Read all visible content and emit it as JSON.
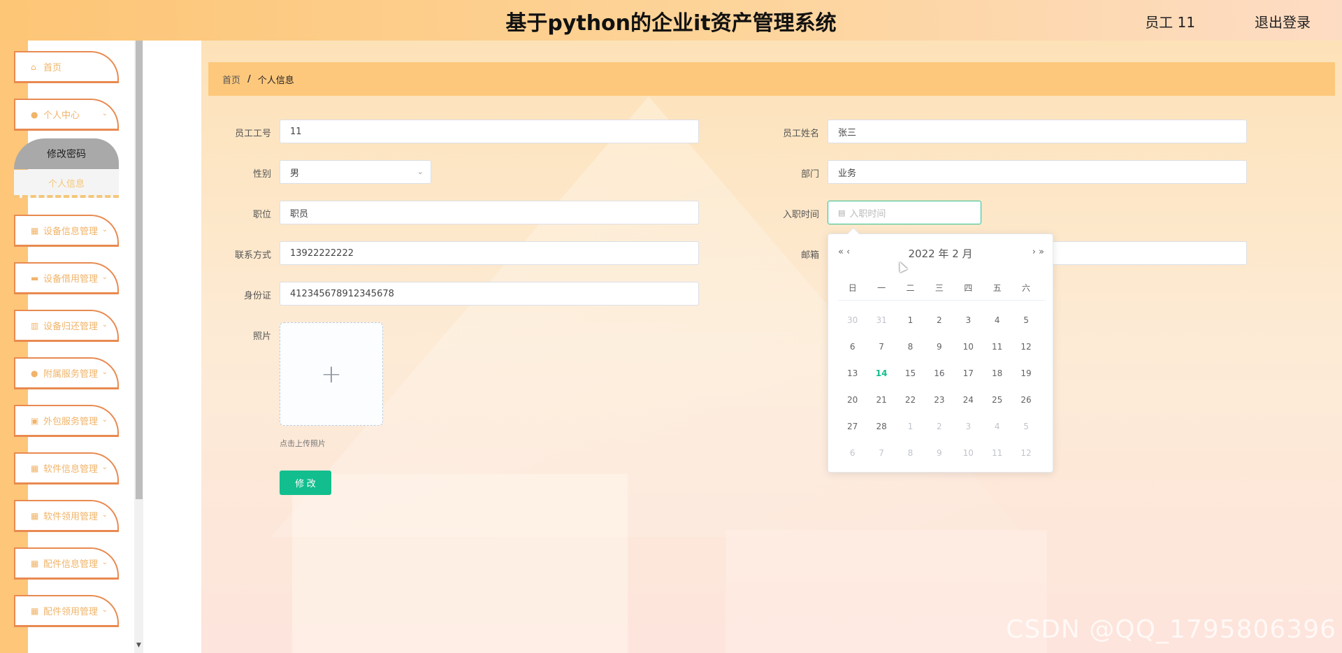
{
  "header": {
    "title": "基于python的企业it资产管理系统",
    "user": "员工 11",
    "logout": "退出登录"
  },
  "sidebar": {
    "items": [
      {
        "label": "首页",
        "icon": "home-icon"
      },
      {
        "label": "个人中心",
        "icon": "user-icon"
      },
      {
        "label": "设备信息管理",
        "icon": "grid-icon"
      },
      {
        "label": "设备借用管理",
        "icon": "video-icon"
      },
      {
        "label": "设备归还管理",
        "icon": "chart-icon"
      },
      {
        "label": "附属服务管理",
        "icon": "user-icon"
      },
      {
        "label": "外包服务管理",
        "icon": "briefcase-icon"
      },
      {
        "label": "软件信息管理",
        "icon": "grid-icon"
      },
      {
        "label": "软件领用管理",
        "icon": "grid-icon"
      },
      {
        "label": "配件信息管理",
        "icon": "grid-icon"
      },
      {
        "label": "配件领用管理",
        "icon": "grid-icon"
      }
    ],
    "submenu": {
      "active": "修改密码",
      "other": "个人信息"
    }
  },
  "breadcrumb": {
    "home": "首页",
    "separator": "/",
    "current": "个人信息"
  },
  "form": {
    "emp_no_label": "员工工号",
    "emp_no": "11",
    "emp_name_label": "员工姓名",
    "emp_name": "张三",
    "gender_label": "性别",
    "gender": "男",
    "dept_label": "部门",
    "dept": "业务",
    "position_label": "职位",
    "position": "职员",
    "hire_label": "入职时间",
    "hire_placeholder": "入职时间",
    "phone_label": "联系方式",
    "phone": "13922222222",
    "email_label": "邮箱",
    "id_label": "身份证",
    "id_no": "412345678912345678",
    "photo_label": "照片",
    "upload_tip": "点击上传照片",
    "submit": "修 改"
  },
  "picker": {
    "title": "2022 年  2 月",
    "weekdays": [
      "日",
      "一",
      "二",
      "三",
      "四",
      "五",
      "六"
    ],
    "weeks": [
      [
        [
          "30",
          1
        ],
        [
          "31",
          1
        ],
        [
          "1",
          0
        ],
        [
          "2",
          0
        ],
        [
          "3",
          0
        ],
        [
          "4",
          0
        ],
        [
          "5",
          0
        ]
      ],
      [
        [
          "6",
          0
        ],
        [
          "7",
          0
        ],
        [
          "8",
          0
        ],
        [
          "9",
          0
        ],
        [
          "10",
          0
        ],
        [
          "11",
          0
        ],
        [
          "12",
          0
        ]
      ],
      [
        [
          "13",
          0
        ],
        [
          "14",
          2
        ],
        [
          "15",
          0
        ],
        [
          "16",
          0
        ],
        [
          "17",
          0
        ],
        [
          "18",
          0
        ],
        [
          "19",
          0
        ]
      ],
      [
        [
          "20",
          0
        ],
        [
          "21",
          0
        ],
        [
          "22",
          0
        ],
        [
          "23",
          0
        ],
        [
          "24",
          0
        ],
        [
          "25",
          0
        ],
        [
          "26",
          0
        ]
      ],
      [
        [
          "27",
          0
        ],
        [
          "28",
          0
        ],
        [
          "1",
          1
        ],
        [
          "2",
          1
        ],
        [
          "3",
          1
        ],
        [
          "4",
          1
        ],
        [
          "5",
          1
        ]
      ],
      [
        [
          "6",
          1
        ],
        [
          "7",
          1
        ],
        [
          "8",
          1
        ],
        [
          "9",
          1
        ],
        [
          "10",
          1
        ],
        [
          "11",
          1
        ],
        [
          "12",
          1
        ]
      ]
    ]
  },
  "watermark": "CSDN @QQ_1795806396"
}
